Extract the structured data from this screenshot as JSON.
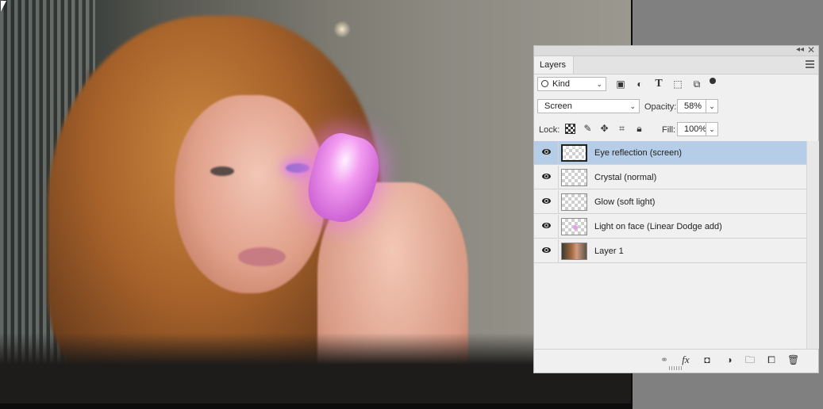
{
  "panel": {
    "tab_label": "Layers",
    "collapse_glyph": "◂◂",
    "close_glyph": "✕"
  },
  "filter": {
    "kind_label": "Kind",
    "kind_chevron": "⌄",
    "icons": [
      "image-filter-icon",
      "adjustment-filter-icon",
      "type-filter-icon",
      "shape-filter-icon",
      "smart-object-filter-icon"
    ]
  },
  "blend": {
    "mode": "Screen",
    "chevron": "⌄",
    "opacity_label": "Opacity:",
    "opacity_value": "58%"
  },
  "lock": {
    "label": "Lock:",
    "fill_label": "Fill:",
    "fill_value": "100%"
  },
  "layers": [
    {
      "name": "Eye reflection (screen)",
      "selected": true,
      "thumb": "transparent"
    },
    {
      "name": "Crystal (normal)",
      "selected": false,
      "thumb": "transparent"
    },
    {
      "name": "Glow (soft light)",
      "selected": false,
      "thumb": "transparent"
    },
    {
      "name": "Light on face (Linear Dodge add)",
      "selected": false,
      "thumb": "transparent-pink"
    },
    {
      "name": "Layer 1",
      "selected": false,
      "thumb": "photo"
    }
  ],
  "bottom_icons": [
    "link-layers-icon",
    "fx-icon",
    "add-mask-icon",
    "new-adjustment-icon",
    "new-group-icon",
    "new-layer-icon",
    "delete-layer-icon"
  ],
  "colors": {
    "selection": "#b6cde7",
    "panel_bg": "#f0f0f0",
    "workspace_bg": "#808080",
    "crystal": "#e07ae0"
  }
}
